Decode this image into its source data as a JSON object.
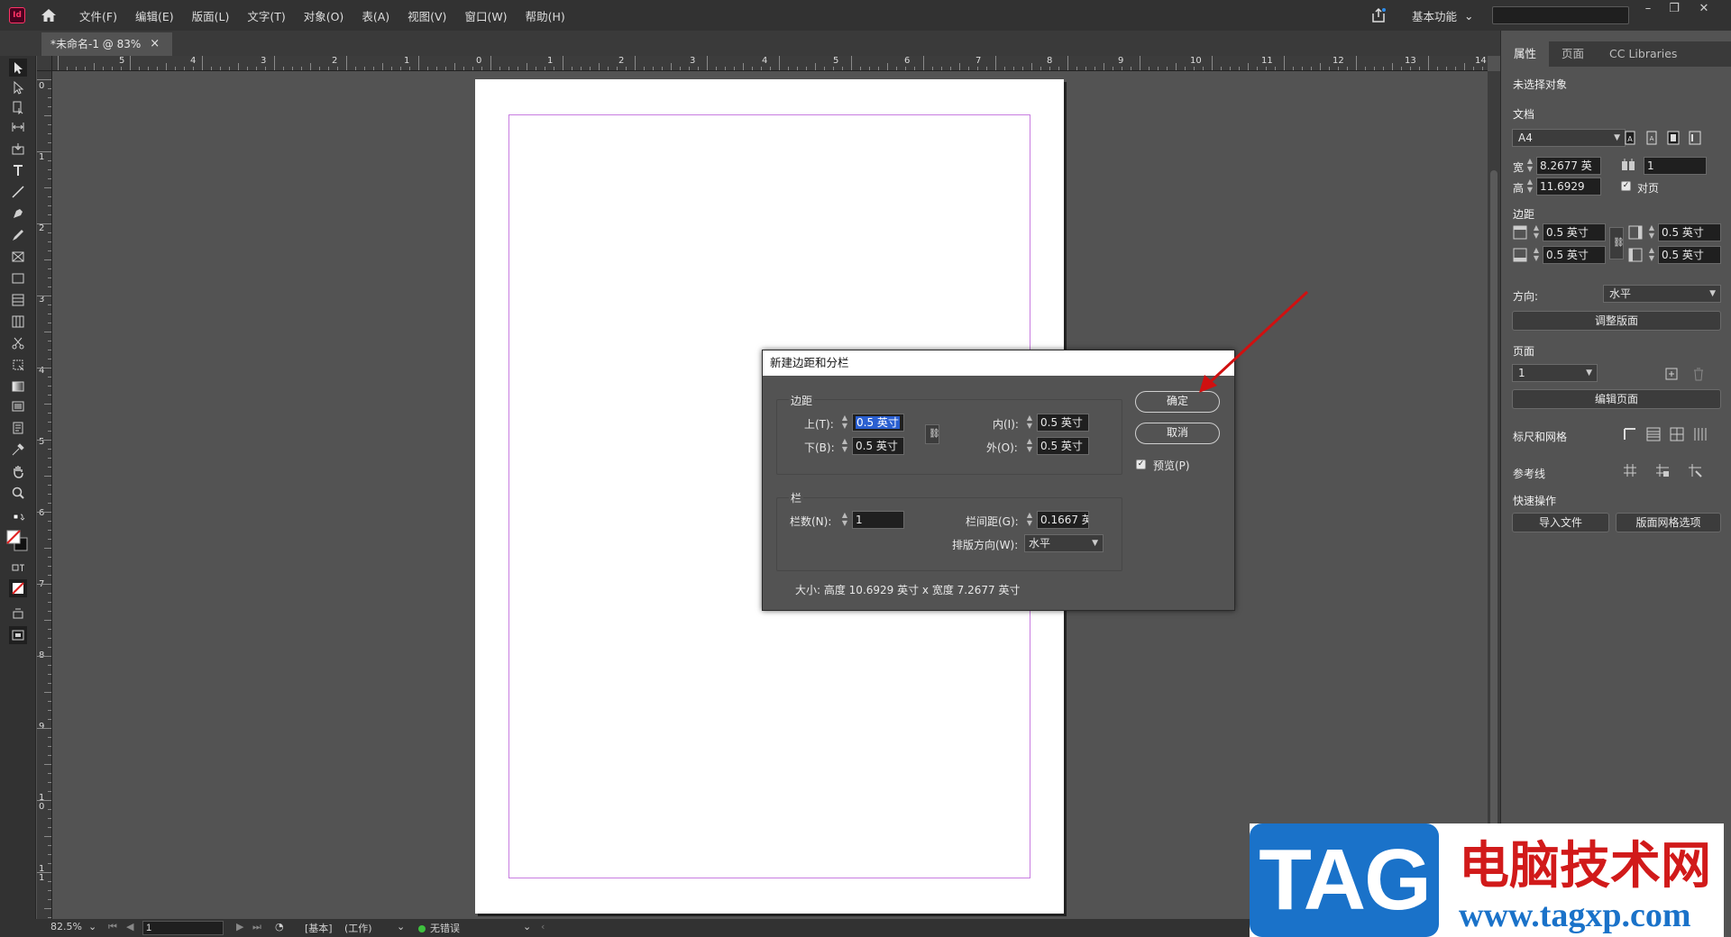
{
  "app": {
    "logo_text": "Id",
    "accent_color": "#ff3366"
  },
  "menu": {
    "items": [
      "文件(F)",
      "编辑(E)",
      "版面(L)",
      "文字(T)",
      "对象(O)",
      "表(A)",
      "视图(V)",
      "窗口(W)",
      "帮助(H)"
    ],
    "workspace": "基本功能",
    "search_value": ""
  },
  "document_tab": {
    "title": "*未命名-1 @ 83%",
    "close": "×"
  },
  "rulers": {
    "horizontal": [
      "5",
      "4",
      "3",
      "2",
      "1",
      "0",
      "1",
      "2",
      "3",
      "4",
      "5",
      "6",
      "7",
      "8",
      "9",
      "10",
      "11",
      "12",
      "13",
      "14"
    ],
    "vertical": [
      "0",
      "1",
      "2",
      "3",
      "4",
      "5",
      "6",
      "7",
      "8",
      "9",
      "10",
      "11"
    ]
  },
  "status_bar": {
    "zoom": "82.5%",
    "page": "1",
    "master": "[基本]",
    "mode": "(工作)",
    "preflight": "无错误"
  },
  "panel": {
    "tabs": [
      "属性",
      "页面",
      "CC Libraries"
    ],
    "no_selection": "未选择对象",
    "document_label": "文档",
    "page_size": "A4",
    "width_label": "宽",
    "width_value": "8.2677 英",
    "height_label": "高",
    "height_value": "11.6929",
    "pages_value": "1",
    "facing_label": "对页",
    "margins_label": "边距",
    "margin_top": "0.5 英寸",
    "margin_bottom": "0.5 英寸",
    "margin_inside": "0.5 英寸",
    "margin_outside": "0.5 英寸",
    "orientation_label": "方向:",
    "orientation_value": "水平",
    "adjust_layout": "调整版面",
    "page_section_label": "页面",
    "page_value": "1",
    "edit_page": "编辑页面",
    "rulers_grids_label": "标尺和网格",
    "guides_label": "参考线",
    "quick_actions_label": "快速操作",
    "import_file": "导入文件",
    "layout_grid_options": "版面网格选项"
  },
  "dialog": {
    "title": "新建边距和分栏",
    "margins_group": "边距",
    "top_label": "上(T):",
    "top_value": "0.5 英寸",
    "bottom_label": "下(B):",
    "bottom_value": "0.5 英寸",
    "inside_label": "内(I):",
    "inside_value": "0.5 英寸",
    "outside_label": "外(O):",
    "outside_value": "0.5 英寸",
    "columns_group": "栏",
    "columns_label": "栏数(N):",
    "columns_value": "1",
    "gutter_label": "栏间距(G):",
    "gutter_value": "0.1667 英",
    "direction_label": "排版方向(W):",
    "direction_value": "水平",
    "ok": "确定",
    "cancel": "取消",
    "preview_label": "预览(P)",
    "size_text": "大小:  高度 10.6929 英寸 x 宽度 7.2677 英寸"
  },
  "watermark": {
    "badge": "TAG",
    "title": "电脑技术网",
    "url": "www.tagxp.com"
  }
}
